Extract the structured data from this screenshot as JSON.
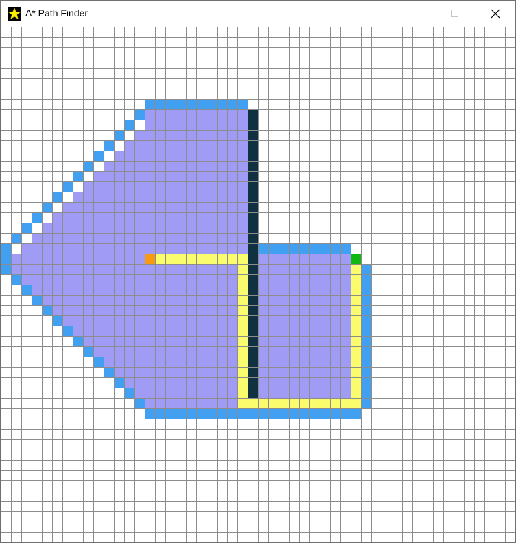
{
  "window": {
    "title": "A* Path Finder",
    "icon": "star-icon",
    "controls": [
      "minimize-icon",
      "maximize-icon",
      "close-icon"
    ]
  },
  "colors": {
    "empty": "#ffffff",
    "grid_line": "#8c8c8c",
    "open_set": "#42a0f2",
    "closed_set": "#a09cf6",
    "wall": "#10313f",
    "path": "#fbfb6e",
    "start": "#f79a12",
    "goal": "#11b811"
  },
  "grid": {
    "cols": 50,
    "rows": 50,
    "start": [
      14,
      22
    ],
    "goal": [
      34,
      22
    ],
    "wall": {
      "col": 24,
      "rows": [
        8,
        35
      ]
    },
    "closed_runs": [
      [
        8,
        14,
        23
      ],
      [
        9,
        14,
        23
      ],
      [
        10,
        13,
        23
      ],
      [
        11,
        12,
        23
      ],
      [
        12,
        11,
        23
      ],
      [
        13,
        10,
        23
      ],
      [
        14,
        9,
        23
      ],
      [
        15,
        8,
        23
      ],
      [
        16,
        7,
        23
      ],
      [
        17,
        6,
        23
      ],
      [
        18,
        5,
        23
      ],
      [
        19,
        4,
        23
      ],
      [
        20,
        3,
        23
      ],
      [
        21,
        2,
        23
      ],
      [
        22,
        1,
        23
      ],
      [
        23,
        1,
        23
      ],
      [
        24,
        2,
        23
      ],
      [
        25,
        3,
        23
      ],
      [
        26,
        4,
        23
      ],
      [
        27,
        5,
        23
      ],
      [
        28,
        6,
        23
      ],
      [
        29,
        7,
        23
      ],
      [
        30,
        8,
        23
      ],
      [
        31,
        9,
        23
      ],
      [
        32,
        10,
        23
      ],
      [
        33,
        11,
        23
      ],
      [
        34,
        12,
        23
      ],
      [
        35,
        13,
        23
      ],
      [
        36,
        14,
        23
      ],
      [
        22,
        25,
        33
      ],
      [
        23,
        25,
        34
      ],
      [
        24,
        25,
        34
      ],
      [
        25,
        25,
        34
      ],
      [
        26,
        25,
        34
      ],
      [
        27,
        25,
        34
      ],
      [
        28,
        25,
        34
      ],
      [
        29,
        25,
        34
      ],
      [
        30,
        25,
        34
      ],
      [
        31,
        25,
        34
      ],
      [
        32,
        25,
        34
      ],
      [
        33,
        25,
        34
      ],
      [
        34,
        25,
        34
      ],
      [
        35,
        25,
        34
      ],
      [
        36,
        25,
        34
      ]
    ],
    "open_runs": [
      [
        7,
        14,
        23
      ],
      [
        8,
        13,
        13
      ],
      [
        9,
        12,
        12
      ],
      [
        10,
        11,
        11
      ],
      [
        11,
        10,
        10
      ],
      [
        12,
        9,
        9
      ],
      [
        13,
        8,
        8
      ],
      [
        14,
        7,
        7
      ],
      [
        15,
        6,
        6
      ],
      [
        16,
        5,
        5
      ],
      [
        17,
        4,
        4
      ],
      [
        18,
        3,
        3
      ],
      [
        19,
        2,
        2
      ],
      [
        20,
        1,
        1
      ],
      [
        21,
        0,
        0
      ],
      [
        22,
        0,
        0
      ],
      [
        23,
        0,
        0
      ],
      [
        24,
        1,
        1
      ],
      [
        25,
        2,
        2
      ],
      [
        26,
        3,
        3
      ],
      [
        27,
        4,
        4
      ],
      [
        28,
        5,
        5
      ],
      [
        29,
        6,
        6
      ],
      [
        30,
        7,
        7
      ],
      [
        31,
        8,
        8
      ],
      [
        32,
        9,
        9
      ],
      [
        33,
        10,
        10
      ],
      [
        34,
        11,
        11
      ],
      [
        35,
        12,
        12
      ],
      [
        36,
        13,
        13
      ],
      [
        37,
        14,
        34
      ],
      [
        21,
        25,
        33
      ],
      [
        22,
        34,
        34
      ],
      [
        23,
        35,
        35
      ],
      [
        24,
        35,
        35
      ],
      [
        25,
        35,
        35
      ],
      [
        26,
        35,
        35
      ],
      [
        27,
        35,
        35
      ],
      [
        28,
        35,
        35
      ],
      [
        29,
        35,
        35
      ],
      [
        30,
        35,
        35
      ],
      [
        31,
        35,
        35
      ],
      [
        32,
        35,
        35
      ],
      [
        33,
        35,
        35
      ],
      [
        34,
        35,
        35
      ],
      [
        35,
        35,
        35
      ],
      [
        36,
        35,
        35
      ]
    ],
    "path": [
      [
        15,
        22
      ],
      [
        16,
        22
      ],
      [
        17,
        22
      ],
      [
        18,
        22
      ],
      [
        19,
        22
      ],
      [
        20,
        22
      ],
      [
        21,
        22
      ],
      [
        22,
        22
      ],
      [
        23,
        22
      ],
      [
        23,
        23
      ],
      [
        23,
        24
      ],
      [
        23,
        25
      ],
      [
        23,
        26
      ],
      [
        23,
        27
      ],
      [
        23,
        28
      ],
      [
        23,
        29
      ],
      [
        23,
        30
      ],
      [
        23,
        31
      ],
      [
        23,
        32
      ],
      [
        23,
        33
      ],
      [
        23,
        34
      ],
      [
        23,
        35
      ],
      [
        23,
        36
      ],
      [
        24,
        36
      ],
      [
        25,
        36
      ],
      [
        26,
        36
      ],
      [
        27,
        36
      ],
      [
        28,
        36
      ],
      [
        29,
        36
      ],
      [
        30,
        36
      ],
      [
        31,
        36
      ],
      [
        32,
        36
      ],
      [
        33,
        36
      ],
      [
        34,
        36
      ],
      [
        34,
        35
      ],
      [
        34,
        34
      ],
      [
        34,
        33
      ],
      [
        34,
        32
      ],
      [
        34,
        31
      ],
      [
        34,
        30
      ],
      [
        34,
        29
      ],
      [
        34,
        28
      ],
      [
        34,
        27
      ],
      [
        34,
        26
      ],
      [
        34,
        25
      ],
      [
        34,
        24
      ],
      [
        34,
        23
      ]
    ]
  }
}
